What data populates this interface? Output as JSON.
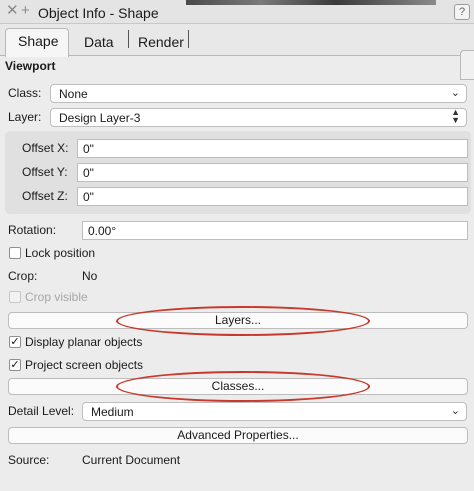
{
  "window": {
    "title": "Object Info - Shape",
    "help_label": "?"
  },
  "tabs": [
    {
      "label": "Shape"
    },
    {
      "label": "Data"
    },
    {
      "label": "Render"
    }
  ],
  "section": {
    "title": "Viewport"
  },
  "class_field": {
    "label": "Class:",
    "value": "None"
  },
  "layer_field": {
    "label": "Layer:",
    "value": "Design Layer-3"
  },
  "offsets": [
    {
      "label": "Offset X:",
      "value": "0\""
    },
    {
      "label": "Offset Y:",
      "value": "0\""
    },
    {
      "label": "Offset Z:",
      "value": "0\""
    }
  ],
  "rotation": {
    "label": "Rotation:",
    "value": "0.00°"
  },
  "lock_position": {
    "label": "Lock position",
    "checked": false
  },
  "crop": {
    "label": "Crop:",
    "value": "No"
  },
  "crop_visible": {
    "label": "Crop visible",
    "checked": false,
    "enabled": false
  },
  "layers_button": {
    "label": "Layers..."
  },
  "display_planar": {
    "label": "Display planar objects",
    "checked": true
  },
  "project_screen": {
    "label": "Project screen objects",
    "checked": true
  },
  "classes_button": {
    "label": "Classes..."
  },
  "detail_level": {
    "label": "Detail Level:",
    "value": "Medium"
  },
  "advanced_button": {
    "label": "Advanced Properties..."
  },
  "source": {
    "label": "Source:",
    "value": "Current Document"
  },
  "colors": {
    "annotation": "#c8382b",
    "panel_bg": "#ececec"
  }
}
